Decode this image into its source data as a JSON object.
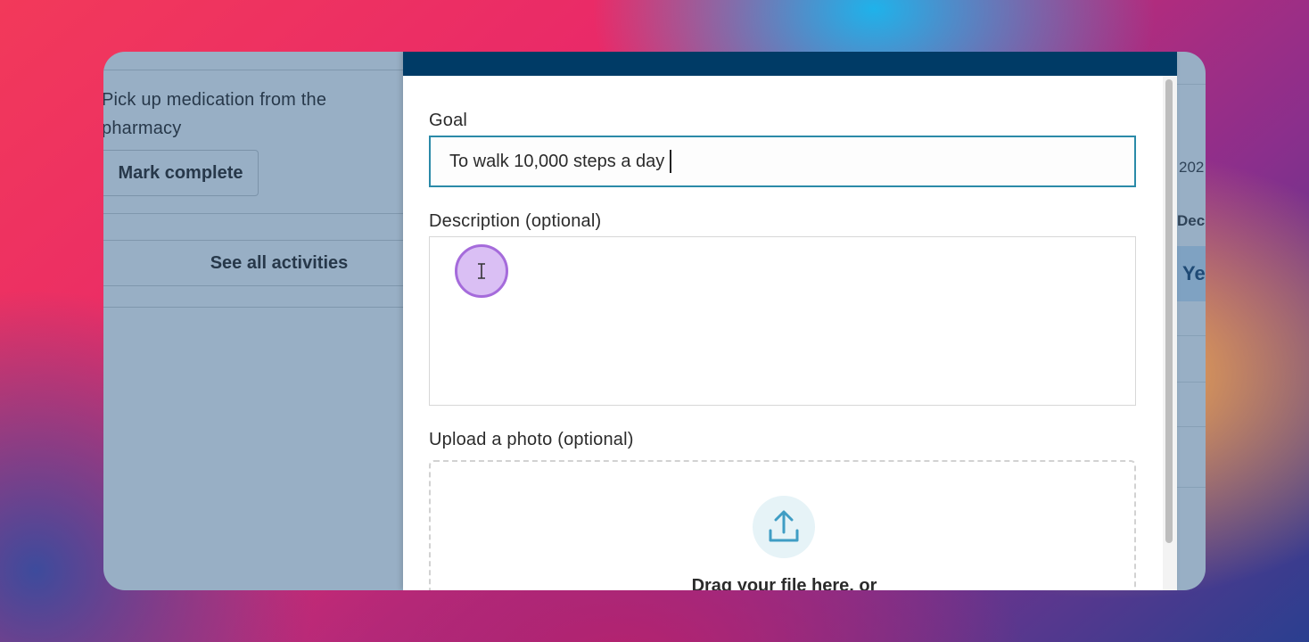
{
  "activities": {
    "item_text": "Pick up medication from the pharmacy",
    "mark_complete_label": "Mark complete",
    "see_all_label": "See all activities"
  },
  "background_page": {
    "year_fragment": "202",
    "month_fragment": "Dec",
    "highlight_fragment": "Ye"
  },
  "form": {
    "goal_label": "Goal",
    "goal_value": "To walk 10,000 steps a day",
    "description_label": "Description (optional)",
    "description_value": "",
    "upload_label": "Upload a photo (optional)",
    "drag_text": "Drag your file here, or"
  },
  "icons": {
    "upload": "upload-icon",
    "text_cursor": "text-cursor-icon"
  },
  "colors": {
    "header": "#003b66",
    "focus_border": "#2b8aa8",
    "overlay": "#98afc5",
    "cursor_ring": "#a56bdb"
  }
}
